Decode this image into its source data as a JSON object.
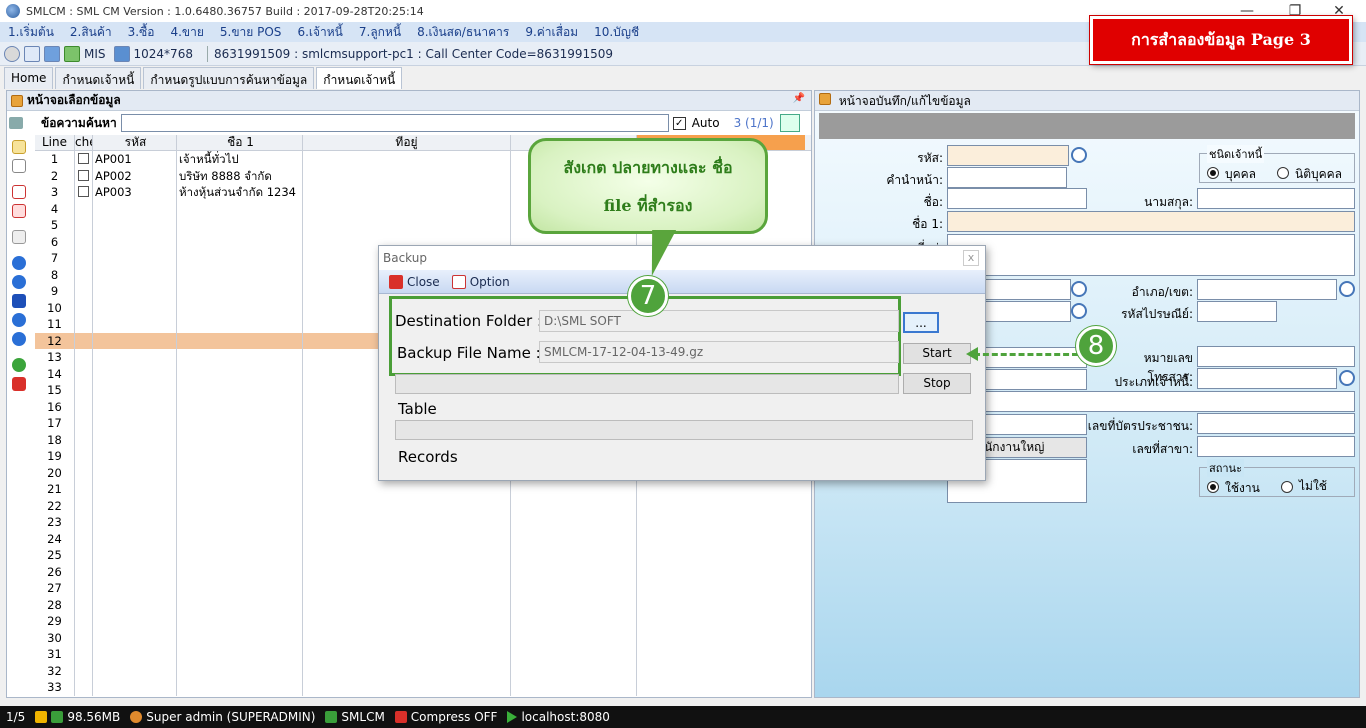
{
  "window": {
    "title": "SMLCM : SML CM Version : 1.0.6480.36757 Build : 2017-09-28T20:25:14",
    "controls": {
      "minimize": "—",
      "maximize": "❐",
      "close": "✕"
    }
  },
  "menu": [
    "1.เริ่มต้น",
    "2.สินค้า",
    "3.ซื้อ",
    "4.ขาย",
    "5.ขาย POS",
    "6.เจ้าหนี้",
    "7.ลูกหนี้",
    "8.เงินสด/ธนาคาร",
    "9.ค่าเสื่อม",
    "10.บัญชี"
  ],
  "toolbar": {
    "mis_label": "MIS",
    "resolution": "1024*768",
    "support_info": "8631991509 : smlcmsupport-pc1 : Call Center Code=8631991509"
  },
  "tabs": [
    "Home",
    "กำหนดเจ้าหนี้",
    "กำหนดรูปแบบการค้นหาข้อมูล",
    "กำหนดเจ้าหนี้"
  ],
  "left_pane": {
    "title": "หน้าจอเลือกข้อมูล",
    "pin": "📌",
    "search_label": "ข้อความค้นหา",
    "auto_checked": "✓",
    "auto_label": "Auto",
    "count": "3 (1/1)",
    "columns": [
      "Line",
      "che",
      "รหัส",
      "ชื่อ 1",
      "ที่อยู่",
      "",
      ""
    ],
    "rows": [
      {
        "line": "1",
        "code": "AP001",
        "name": "เจ้าหนี้ทั่วไป"
      },
      {
        "line": "2",
        "code": "AP002",
        "name": "บริษัท 8888 จำกัด"
      },
      {
        "line": "3",
        "code": "AP003",
        "name": "ห้างหุ้นส่วนจำกัด 1234"
      },
      {
        "line": "4"
      },
      {
        "line": "5"
      },
      {
        "line": "6"
      },
      {
        "line": "7"
      },
      {
        "line": "8"
      },
      {
        "line": "9"
      },
      {
        "line": "10"
      },
      {
        "line": "11"
      },
      {
        "line": "12",
        "selected": true
      },
      {
        "line": "13"
      },
      {
        "line": "14"
      },
      {
        "line": "15"
      },
      {
        "line": "16"
      },
      {
        "line": "17"
      },
      {
        "line": "18"
      },
      {
        "line": "19"
      },
      {
        "line": "20"
      },
      {
        "line": "21"
      },
      {
        "line": "22"
      },
      {
        "line": "23"
      },
      {
        "line": "24"
      },
      {
        "line": "25"
      },
      {
        "line": "26"
      },
      {
        "line": "27"
      },
      {
        "line": "28"
      },
      {
        "line": "29"
      },
      {
        "line": "30"
      },
      {
        "line": "31"
      },
      {
        "line": "32"
      },
      {
        "line": "33"
      }
    ]
  },
  "right_pane": {
    "title": "หน้าจอบันทึก/แก้ไขข้อมูล",
    "labels": {
      "code": "รหัส:",
      "prefix": "คำนำหน้า:",
      "first_name": "ชื่อ:",
      "last_name": "นามสกุล:",
      "name1": "ชื่อ 1:",
      "address": "ที่อยู่:",
      "district": "อำเภอ/เขต:",
      "postcode": "รหัสไปรษณีย์:",
      "fax": "หมายเลขโทรสาร:",
      "creditor_type": "ประเภทเจ้าหนี้:",
      "id_card": "เลขที่บัตรประชาชน:",
      "branch_no": "เลขที่สาขา:",
      "branch_type_value": "สำนักงานใหญ่"
    },
    "creditor_kind": {
      "title": "ชนิดเจ้าหนี้",
      "person": "บุคคล",
      "juristic": "นิติบุคคล"
    },
    "status": {
      "title": "สถานะ",
      "active": "ใช้งาน",
      "inactive": "ไม่ใช้"
    }
  },
  "backup_dialog": {
    "title": "Backup",
    "close_x": "x",
    "toolbar_close": "Close",
    "toolbar_option": "Option",
    "destination_label": "Destination Folder :",
    "destination_value": "D:\\SML SOFT",
    "browse_label": "...",
    "file_name_label": "Backup File Name :",
    "file_name_value": "SMLCM-17-12-04-13-49.gz",
    "start_label": "Start",
    "stop_label": "Stop",
    "table_label": "Table",
    "records_label": "Records"
  },
  "annotations": {
    "callout_line1": "สังเกต ปลายทางและ ชื่อ",
    "callout_line2": "file ที่สำรอง",
    "step7": "7",
    "step8": "8",
    "page_banner": "การสำลองข้อมูล  Page  3"
  },
  "statusbar": {
    "page": "1/5",
    "memory": "98.56MB",
    "user": "Super admin (SUPERADMIN)",
    "app": "SMLCM",
    "compress": "Compress OFF",
    "server": "localhost:8080"
  },
  "colors": {
    "accent_green": "#4fa33c",
    "banner_red": "#e00000",
    "selected_row": "#f3c49b"
  }
}
